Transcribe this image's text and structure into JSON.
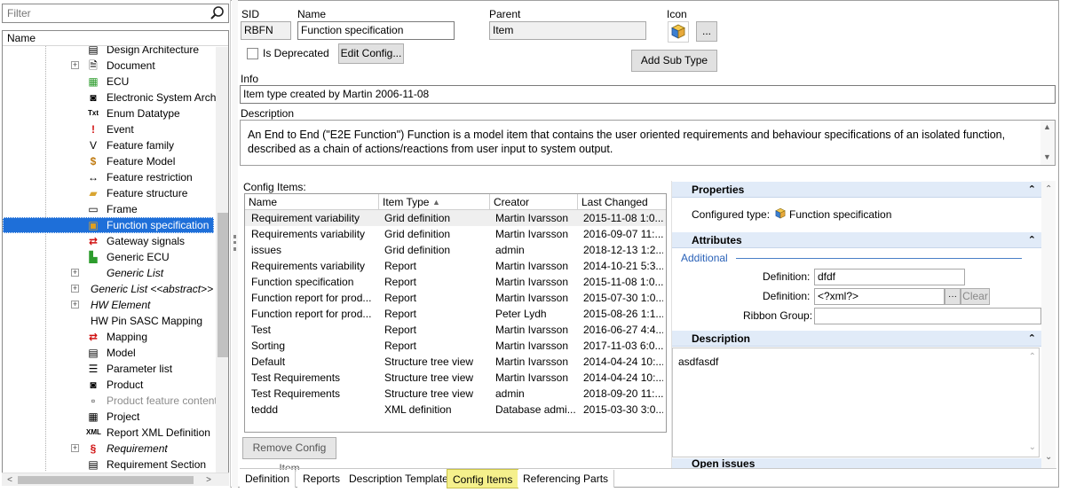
{
  "filter": {
    "placeholder": "Filter"
  },
  "tree": {
    "column_header": "Name",
    "items": [
      {
        "label": "Design Architecture",
        "icon": "design-architecture-icon",
        "glyph": "▤",
        "expand": false
      },
      {
        "label": "Document",
        "icon": "document-icon",
        "glyph": "🗎",
        "expand": true
      },
      {
        "label": "ECU",
        "icon": "ecu-icon",
        "glyph": "▦",
        "expand": false
      },
      {
        "label": "Electronic System Archit",
        "icon": "camera-icon",
        "glyph": "◙",
        "expand": false
      },
      {
        "label": "Enum Datatype",
        "icon": "text-icon",
        "glyph": "Txt",
        "expand": false
      },
      {
        "label": "Event",
        "icon": "exclamation-icon",
        "glyph": "!",
        "expand": false
      },
      {
        "label": "Feature family",
        "icon": "feature-family-icon",
        "glyph": "V",
        "expand": false
      },
      {
        "label": "Feature Model",
        "icon": "feature-model-icon",
        "glyph": "$",
        "expand": false
      },
      {
        "label": "Feature restriction",
        "icon": "arrows-icon",
        "glyph": "↔",
        "expand": false
      },
      {
        "label": "Feature structure",
        "icon": "folder-open-icon",
        "glyph": "▰",
        "expand": false
      },
      {
        "label": "Frame",
        "icon": "frame-icon",
        "glyph": "▭",
        "expand": false
      },
      {
        "label": "Function specification",
        "icon": "cube-icon",
        "glyph": "▣",
        "expand": false,
        "selected": true
      },
      {
        "label": "Gateway signals",
        "icon": "swap-arrows-icon",
        "glyph": "⇄",
        "expand": false
      },
      {
        "label": "Generic ECU",
        "icon": "generic-ecu-icon",
        "glyph": "▙",
        "expand": false
      },
      {
        "label": "Generic List",
        "icon": "none",
        "glyph": "",
        "expand": true,
        "italic": true,
        "noicon": false
      },
      {
        "label": "Generic List <<abstract>>",
        "icon": "none",
        "glyph": "",
        "expand": true,
        "italic": true,
        "noicon": true
      },
      {
        "label": "HW Element",
        "icon": "none",
        "glyph": "",
        "expand": true,
        "italic": true,
        "noicon": true
      },
      {
        "label": "HW Pin SASC Mapping",
        "icon": "none",
        "glyph": "",
        "expand": false,
        "noicon": true
      },
      {
        "label": "Mapping",
        "icon": "mapping-icon",
        "glyph": "⇄",
        "expand": false
      },
      {
        "label": "Model",
        "icon": "model-icon",
        "glyph": "▤",
        "expand": false
      },
      {
        "label": "Parameter list",
        "icon": "parameter-list-icon",
        "glyph": "☰",
        "expand": false
      },
      {
        "label": "Product",
        "icon": "product-icon",
        "glyph": "◙",
        "expand": false
      },
      {
        "label": "Product feature content",
        "icon": "product-feature-icon",
        "glyph": "▫",
        "expand": false,
        "grey": true
      },
      {
        "label": "Project",
        "icon": "project-icon",
        "glyph": "▦",
        "expand": false
      },
      {
        "label": "Report XML Definition",
        "icon": "xml-icon",
        "glyph": "XML",
        "expand": false
      },
      {
        "label": "Requirement",
        "icon": "section-icon",
        "glyph": "§",
        "expand": true,
        "italic": true
      },
      {
        "label": "Requirement Section",
        "icon": "requirement-section-icon",
        "glyph": "▤",
        "expand": false
      }
    ]
  },
  "header": {
    "sid_label": "SID",
    "sid_value": "RBFN",
    "name_label": "Name",
    "name_value": "Function specification",
    "parent_label": "Parent",
    "parent_value": "Item",
    "icon_label": "Icon",
    "browse_label": "...",
    "deprecated_label": "Is Deprecated",
    "edit_config_label": "Edit Config...",
    "add_sub_type_label": "Add Sub Type",
    "info_label": "Info",
    "info_value": "Item type created by Martin 2006-11-08",
    "description_label": "Description",
    "description_value": "An End to End (\"E2E Function\") Function is a model item that contains the user oriented requirements and behaviour specifications of an isolated function, described as a chain of actions/reactions from user input to system output."
  },
  "config_items": {
    "label": "Config Items:",
    "columns": [
      "Name",
      "Item Type",
      "Creator",
      "Last Changed"
    ],
    "rows": [
      [
        "Requirement variability",
        "Grid definition",
        "Martin Ivarsson",
        "2015-11-08 1:0..."
      ],
      [
        "Requirements variability",
        "Grid definition",
        "Martin Ivarsson",
        "2016-09-07 11:..."
      ],
      [
        "issues",
        "Grid definition",
        "admin",
        "2018-12-13 1:2..."
      ],
      [
        "Requirements variability",
        "Report",
        "Martin Ivarsson",
        "2014-10-21 5:3..."
      ],
      [
        "Function specification",
        "Report",
        "Martin Ivarsson",
        "2015-11-08 1:0..."
      ],
      [
        "Function report for prod...",
        "Report",
        "Martin Ivarsson",
        "2015-07-30 1:0..."
      ],
      [
        "Function report for prod...",
        "Report",
        "Peter Lydh",
        "2015-08-26 1:1..."
      ],
      [
        "Test",
        "Report",
        "Martin Ivarsson",
        "2016-06-27 4:4..."
      ],
      [
        "Sorting",
        "Report",
        "Martin Ivarsson",
        "2017-11-03 6:0..."
      ],
      [
        "Default",
        "Structure tree view",
        "Martin Ivarsson",
        "2014-04-24 10:..."
      ],
      [
        "Test Requirements",
        "Structure tree view",
        "Martin Ivarsson",
        "2014-04-24 10:..."
      ],
      [
        "Test Requirements",
        "Structure tree view",
        "admin",
        "2018-09-20 11:..."
      ],
      [
        "teddd",
        "XML definition",
        "Database admi...",
        "2015-03-30 3:0..."
      ]
    ],
    "remove_label": "Remove Config Item"
  },
  "properties": {
    "properties_title": "Properties",
    "configured_type_label": "Configured type:",
    "configured_type_value": "Function specification",
    "attributes_title": "Attributes",
    "additional_label": "Additional",
    "definition_label_1": "Definition:",
    "definition_value_1": "dfdf",
    "definition_label_2": "Definition:",
    "definition_value_2": "<?xml?>",
    "ellipsis_label": "···",
    "clear_label": "Clear",
    "ribbon_group_label": "Ribbon Group:",
    "ribbon_group_value": "",
    "description_title": "Description",
    "description_value": "asdfasdf",
    "open_issues_title": "Open issues"
  },
  "tabs": [
    "Definition",
    "Reports",
    "Description Template",
    "Config Items",
    "Referencing Parts"
  ],
  "active_tab": "Config Items"
}
